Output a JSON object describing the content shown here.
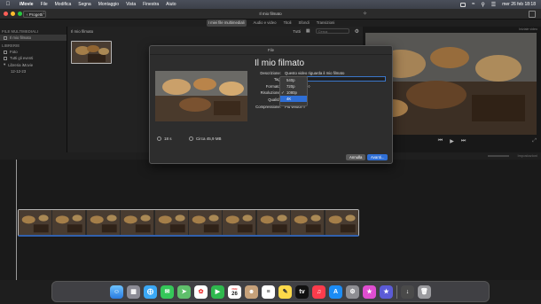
{
  "menubar": {
    "app_name": "iMovie",
    "items": [
      "File",
      "Modifica",
      "Segna",
      "Montaggio",
      "Vista",
      "Finestra",
      "Aiuto"
    ],
    "clock": "mer 26 feb 18:18"
  },
  "toolbar": {
    "back_label": "‹ Progetti",
    "window_title": "Il mio filmato",
    "share_label": "Condividi"
  },
  "viewer": {
    "badge": "Iniziale video"
  },
  "tabs": [
    "I miei file multimediali",
    "Audio e video",
    "Titoli",
    "Sfondi",
    "Transizioni"
  ],
  "active_tab_index": 0,
  "sidebar": {
    "section1": "FILE MULTIMEDIALI",
    "project_item": "Il mio filmato",
    "section2": "LIBRERIE",
    "items": [
      "Foto",
      "Tutti gli eventi",
      "Libreria iMovie",
      "12-12-23"
    ]
  },
  "browser": {
    "header": "Il mio filmato",
    "filter": "Tutti",
    "search_placeholder": "Cerca"
  },
  "timeline": {
    "settings_label": "Impostazioni"
  },
  "dialog": {
    "window_title": "File",
    "project_title": "Il mio filmato",
    "description_label": "Descrizione:",
    "description_value": "Questo video riguarda il mio filmato",
    "tags_label": "Tag:",
    "format_label": "Formato:",
    "format_value": "deo ◊",
    "resolution_label": "Risoluzione:",
    "quality_label": "Qualità:",
    "compression_label": "Compressione:",
    "compression_value": "Più veloce ◊",
    "resolution_options": [
      "540p",
      "720p",
      "1080p",
      "4K"
    ],
    "resolution_checked_index": 2,
    "resolution_highlight_index": 3,
    "duration": "18 s",
    "size": "Circa 45,9 MB",
    "cancel_label": "Annulla",
    "next_label": "Avanti..."
  },
  "dock": {
    "calendar_month": "FEB",
    "calendar_day": "26",
    "apps": [
      "finder-icon",
      "launchpad-icon",
      "safari-icon",
      "messages-icon",
      "maps-icon",
      "photos-icon",
      "facetime-icon",
      "calendar-icon",
      "contacts-icon",
      "reminders-icon",
      "notes-icon",
      "appletv-icon",
      "music-icon",
      "appstore-icon",
      "settings-icon",
      "iphone-mirroring-icon",
      "imovie-dock-icon",
      "downloads-icon",
      "trash-icon"
    ]
  }
}
